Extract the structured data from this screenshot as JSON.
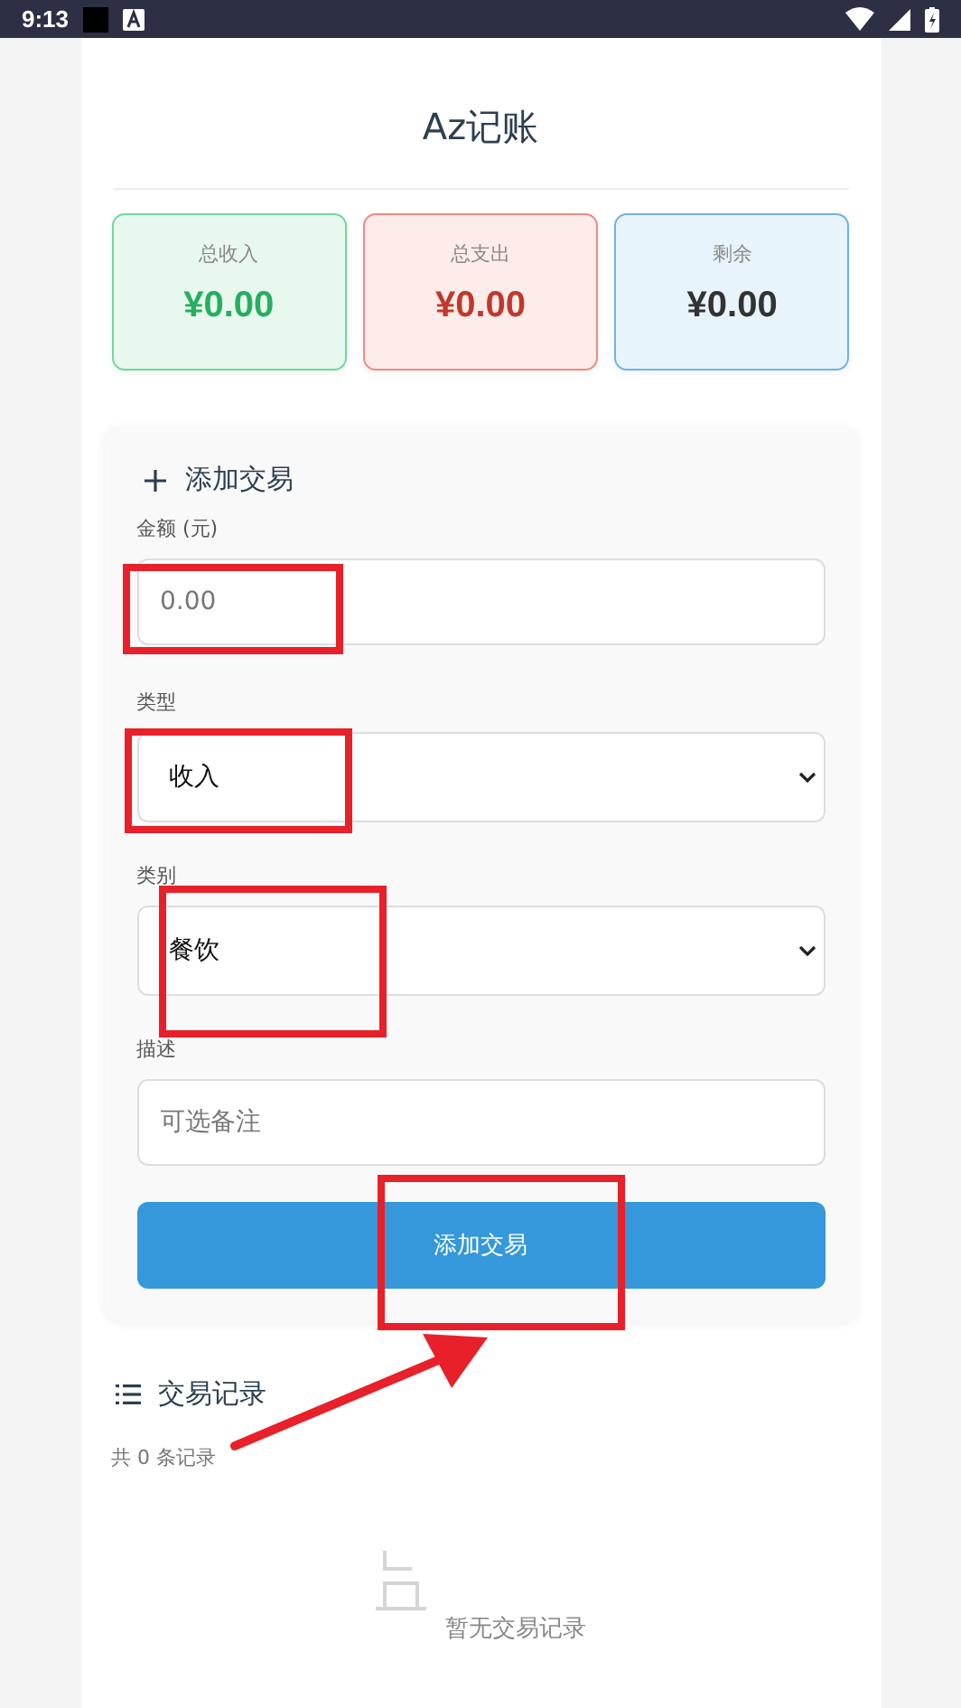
{
  "status_bar": {
    "time": "9:13"
  },
  "header": {
    "title": "Az记账"
  },
  "summary": [
    {
      "kind": "income",
      "label": "总收入",
      "value": "¥0.00"
    },
    {
      "kind": "expense",
      "label": "总支出",
      "value": "¥0.00"
    },
    {
      "kind": "balance",
      "label": "剩余",
      "value": "¥0.00"
    }
  ],
  "form": {
    "title": "添加交易",
    "fields": [
      {
        "kind": "input",
        "label": "金额 (元)",
        "placeholder": "0.00"
      },
      {
        "kind": "select",
        "label": "类型",
        "value": "收入"
      },
      {
        "kind": "select",
        "label": "类别",
        "value": "餐饮"
      },
      {
        "kind": "input",
        "label": "描述",
        "placeholder": "可选备注"
      }
    ],
    "submit": "添加交易"
  },
  "records": {
    "title": "交易记录",
    "count": "共 0 条记录",
    "empty": "暂无交易记录"
  }
}
